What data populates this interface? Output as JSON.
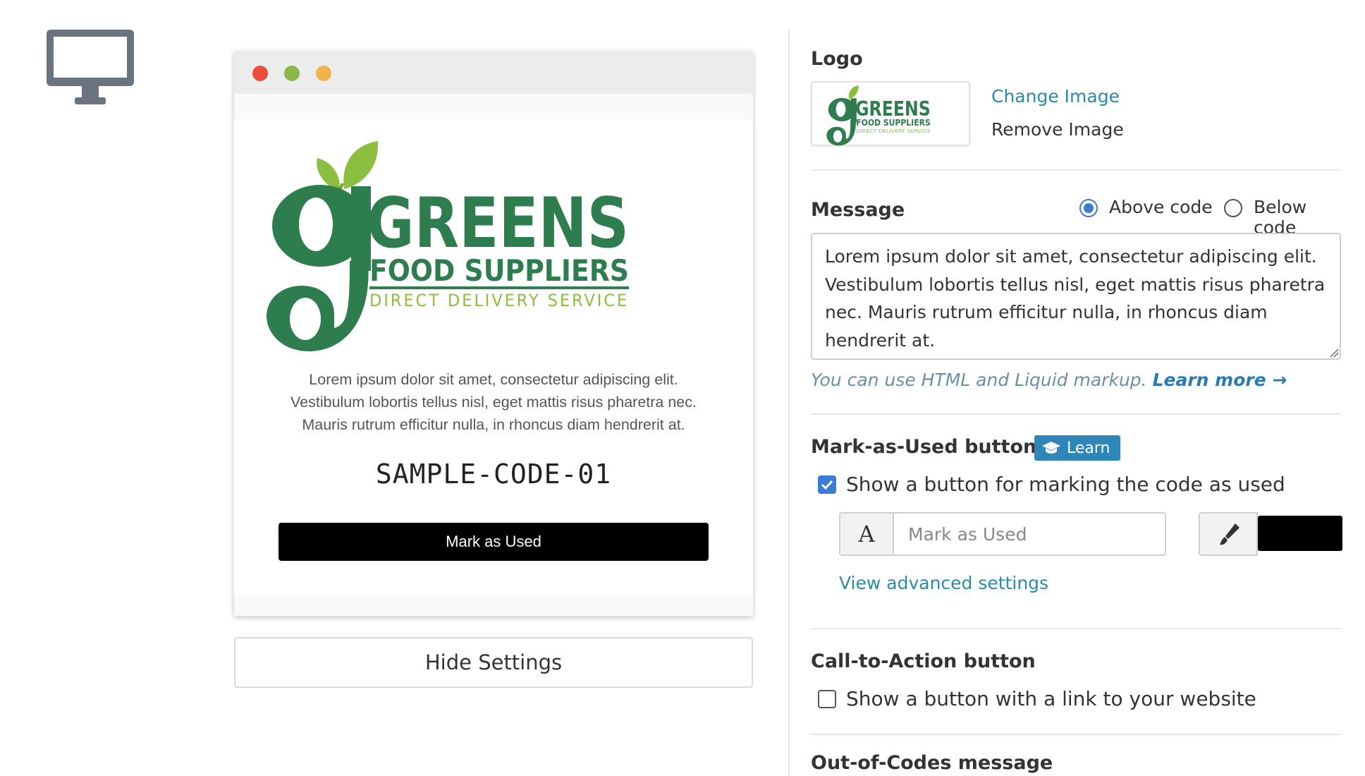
{
  "icons": {
    "monitor": "monitor-icon",
    "brush": "paint-brush-icon",
    "graduation": "graduation-cap-icon",
    "text_format": "text-format-icon"
  },
  "preview": {
    "logo": {
      "word": "GREENS",
      "subword": "FOOD SUPPLIERS",
      "tagline": "DIRECT DELIVERY SERVICE"
    },
    "message_lines": [
      "Lorem ipsum dolor sit amet, consectetur adipiscing elit.",
      "Vestibulum lobortis tellus nisl, eget mattis risus pharetra nec.",
      "Mauris rutrum efficitur nulla, in rhoncus diam hendrerit at."
    ],
    "code": "SAMPLE-CODE-01",
    "mark_button": "Mark as Used"
  },
  "hide_settings": "Hide Settings",
  "settings": {
    "logo": {
      "heading": "Logo",
      "change": "Change Image",
      "remove": "Remove Image"
    },
    "message": {
      "heading": "Message",
      "above": "Above code",
      "below": "Below code",
      "position": "above",
      "text": "Lorem ipsum dolor sit amet, consectetur adipiscing elit. Vestibulum lobortis tellus nisl, eget mattis risus pharetra nec. Mauris rutrum efficitur nulla, in rhoncus diam hendrerit at.",
      "hint": "You can use HTML and Liquid markup.",
      "learn_more": "Learn more →"
    },
    "mark_used": {
      "heading": "Mark-as-Used button",
      "badge": "Learn",
      "checkbox_label": "Show a button for marking the code as used",
      "checked": true,
      "addon": "A",
      "input_placeholder": "Mark as Used",
      "color": "#000000",
      "advanced": "View advanced settings"
    },
    "cta": {
      "heading": "Call-to-Action button",
      "checkbox_label": "Show a button with a link to your website",
      "checked": false
    },
    "out_of_codes": {
      "heading": "Out-of-Codes message"
    }
  },
  "colors": {
    "brand_green": "#2e7d4f",
    "leaf_green": "#8cbf3f",
    "link": "#2b8aa6",
    "accent_blue": "#3a7bd5"
  }
}
